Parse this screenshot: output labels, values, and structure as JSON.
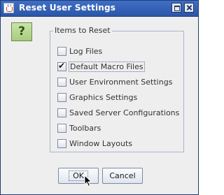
{
  "window": {
    "title": "Reset User Settings"
  },
  "titlebar": {
    "app_icon": "java-coffee-icon",
    "maximize_icon": "maximize-icon",
    "close_icon": "close-icon"
  },
  "prompt_icon": {
    "name": "question-icon",
    "glyph": "?"
  },
  "group": {
    "title": "Items to Reset",
    "items": [
      {
        "label": "Log Files",
        "checked": false
      },
      {
        "label": "Default Macro Files",
        "checked": true
      },
      {
        "label": "User Environment Settings",
        "checked": false
      },
      {
        "label": "Graphics Settings",
        "checked": false
      },
      {
        "label": "Saved Server Configurations",
        "checked": false
      },
      {
        "label": "Toolbars",
        "checked": false
      },
      {
        "label": "Window Layouts",
        "checked": false
      }
    ]
  },
  "buttons": {
    "ok": "OK",
    "cancel": "Cancel"
  },
  "check_glyph": "✔",
  "colors": {
    "titlebar": "#2b56a8",
    "dialog_bg": "#eeeeee",
    "question_icon_bg": "#a8cc7e"
  }
}
